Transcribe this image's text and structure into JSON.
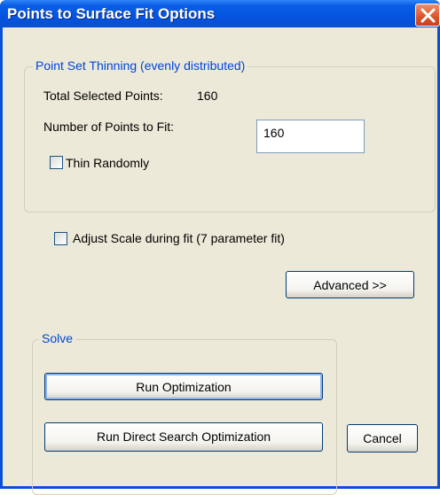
{
  "window": {
    "title": "Points to Surface Fit Options"
  },
  "thinning": {
    "legend": "Point Set Thinning (evenly distributed)",
    "total_label": "Total Selected Points:",
    "total_value": "160",
    "number_label": "Number of Points to Fit:",
    "number_value": "160",
    "thin_randomly_label": "Thin Randomly",
    "thin_randomly_checked": false
  },
  "adjust_scale": {
    "label": "Adjust Scale during fit (7 parameter fit)",
    "checked": false
  },
  "advanced_label": "Advanced >>",
  "solve": {
    "legend": "Solve",
    "run_optimization_label": "Run Optimization",
    "run_direct_label": "Run Direct Search Optimization"
  },
  "cancel_label": "Cancel",
  "colors": {
    "titlebar": "#0454e0",
    "dialog_bg": "#ece9d8",
    "legend_text": "#0046d5",
    "close_button": "#d9532a"
  },
  "icons": {
    "close": "close-icon"
  }
}
